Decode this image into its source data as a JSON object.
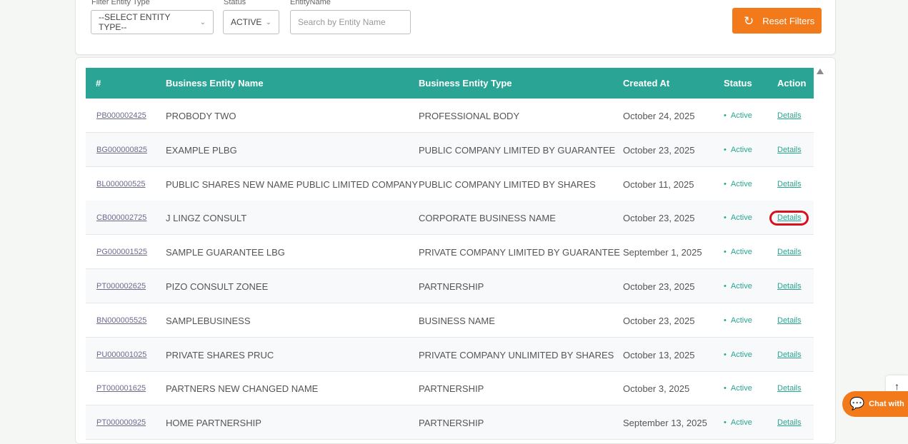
{
  "filters": {
    "entity_type_label": "Filter Entity Type",
    "entity_type_value": "--SELECT ENTITY TYPE--",
    "status_label": "Status",
    "status_value": "ACTIVE",
    "entity_name_label": "EntityName",
    "entity_name_placeholder": "Search by Entity Name",
    "reset_label": "Reset Filters"
  },
  "table": {
    "headers": [
      "#",
      "Business Entity Name",
      "Business Entity Type",
      "Created At",
      "Status",
      "Action"
    ],
    "rows": [
      {
        "code": "PB000002425",
        "name": "PROBODY TWO",
        "type": "PROFESSIONAL BODY",
        "created": "October 24, 2025",
        "status": "Active",
        "action": "Details"
      },
      {
        "code": "BG000000825",
        "name": "EXAMPLE PLBG",
        "type": "PUBLIC COMPANY LIMITED BY GUARANTEE",
        "created": "October 23, 2025",
        "status": "Active",
        "action": "Details"
      },
      {
        "code": "BL000000525",
        "name": "PUBLIC SHARES NEW NAME PUBLIC LIMITED COMPANY",
        "type": "PUBLIC COMPANY LIMITED BY SHARES",
        "created": "October 11, 2025",
        "status": "Active",
        "action": "Details"
      },
      {
        "code": "CB000002725",
        "name": "J LINGZ CONSULT",
        "type": "CORPORATE BUSINESS NAME",
        "created": "October 23, 2025",
        "status": "Active",
        "action": "Details"
      },
      {
        "code": "PG000001525",
        "name": "SAMPLE GUARANTEE LBG",
        "type": "PRIVATE COMPANY LIMITED BY GUARANTEE",
        "created": "September 1, 2025",
        "status": "Active",
        "action": "Details"
      },
      {
        "code": "PT000002625",
        "name": "PIZO CONSULT ZONEE",
        "type": "PARTNERSHIP",
        "created": "October 23, 2025",
        "status": "Active",
        "action": "Details"
      },
      {
        "code": "BN000005525",
        "name": "SAMPLEBUSINESS",
        "type": "BUSINESS NAME",
        "created": "October 23, 2025",
        "status": "Active",
        "action": "Details"
      },
      {
        "code": "PU000001025",
        "name": "PRIVATE SHARES PRUC",
        "type": "PRIVATE COMPANY UNLIMITED BY SHARES",
        "created": "October 13, 2025",
        "status": "Active",
        "action": "Details"
      },
      {
        "code": "PT000001625",
        "name": "PARTNERS NEW CHANGED NAME",
        "type": "PARTNERSHIP",
        "created": "October 3, 2025",
        "status": "Active",
        "action": "Details"
      },
      {
        "code": "PT000000925",
        "name": "HOME PARTNERSHIP",
        "type": "PARTNERSHIP",
        "created": "September 13, 2025",
        "status": "Active",
        "action": "Details"
      }
    ]
  },
  "chat_label": "Chat with",
  "scroll_top_glyph": "↑",
  "colors": {
    "header_bg": "#2aa595",
    "accent_orange": "#f27a1a",
    "active_green": "#27a68f",
    "highlight_red": "#d9101e"
  }
}
